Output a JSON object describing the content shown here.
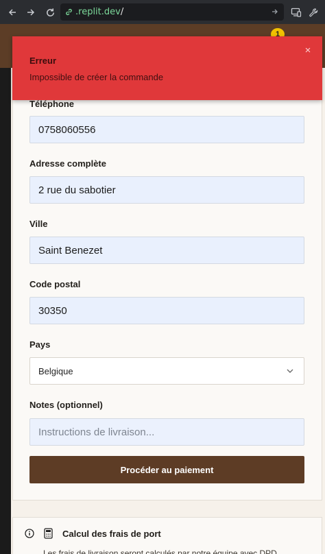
{
  "browser": {
    "url_domain": ".replit.dev",
    "url_path": "/"
  },
  "header": {
    "cart_count": "1"
  },
  "toast": {
    "title": "Erreur",
    "message": "Impossible de créer la commande",
    "close_symbol": "×"
  },
  "form": {
    "phone": {
      "label": "Téléphone",
      "value": "0758060556"
    },
    "address": {
      "label": "Adresse complète",
      "value": "2 rue du sabotier"
    },
    "city": {
      "label": "Ville",
      "value": "Saint Benezet"
    },
    "postal": {
      "label": "Code postal",
      "value": "30350"
    },
    "country": {
      "label": "Pays",
      "selected": "Belgique"
    },
    "notes": {
      "label": "Notes (optionnel)",
      "placeholder": "Instructions de livraison..."
    },
    "submit_label": "Procéder au paiement"
  },
  "shipping": {
    "title": "Calcul des frais de port",
    "text": "Les frais de livraison seront calculés par notre équipe avec DPD"
  },
  "colors": {
    "header_brown": "#5c3d26",
    "toast_red": "#e0383a",
    "badge_yellow": "#f2c200",
    "input_blue": "#e9f0fd"
  }
}
